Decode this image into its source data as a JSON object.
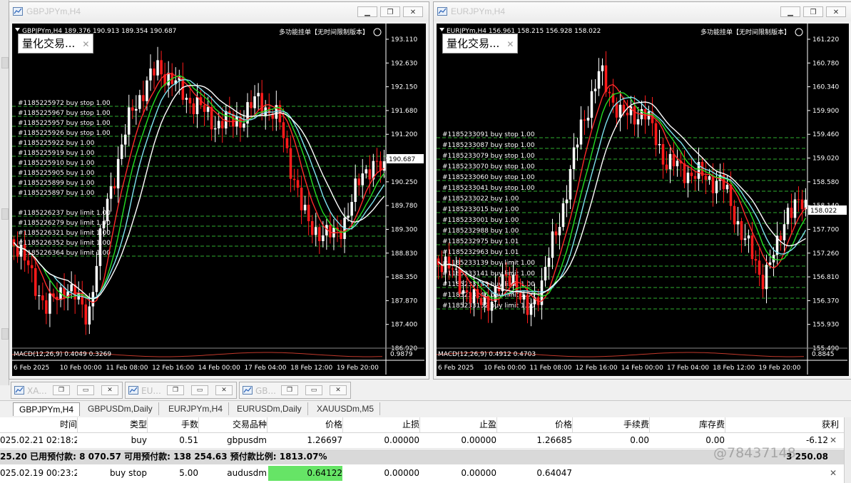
{
  "colors": {
    "bull": "#ffffff",
    "bear": "#ff1a1a",
    "ma_red": "#ff2a2a",
    "ma_green": "#22dd22",
    "ma_cyan": "#7fe3f0",
    "ma_white": "#ffffff",
    "grid_dash": "#2fae2f",
    "macd": "#c0392b"
  },
  "icons": {
    "chart_window": "chart-window-icon",
    "minimize": "minimize-icon",
    "restore": "restore-icon",
    "close": "close-icon",
    "smiley": "smiley-icon"
  },
  "windows": [
    {
      "id": "w1",
      "title": "GBPJPYm,H4",
      "header": "GBPJPYm,H4  189.376 190.913 189.354 190.687",
      "ea_label": "多功能挂单【无时间限制版本】",
      "panel_label": "量化交易...",
      "macd_label": "MACD(12,26,9) 0.4049 0.3269",
      "macd_right": "0.9879",
      "price_badge": "190.687",
      "y_ticks": [
        "193.110",
        "192.630",
        "192.150",
        "191.680",
        "191.200",
        "190.720",
        "190.250",
        "189.780",
        "189.300",
        "188.830",
        "188.350",
        "187.870",
        "187.400",
        "186.920"
      ],
      "x_ticks": [
        "6 Feb 2025",
        "10 Feb 00:00",
        "11 Feb 08:00",
        "12 Feb 16:00",
        "14 Feb 00:00",
        "17 Feb 04:00",
        "18 Feb 12:00",
        "19 Feb 20:00"
      ],
      "orders": [
        "#1185225972 buy stop 1.00",
        "#1185225967 buy stop 1.00",
        "#1185225957 buy stop 1.00",
        "#1185225926 buy stop 1.00",
        "#1185225922 buy 1.00",
        "#1185225919 buy 1.00",
        "#1185225910 buy 1.00",
        "#1185225905 buy 1.00",
        "#1185225899 buy 1.00",
        "#1185225897 buy 1.00",
        "#1185226237 buy limit 1.00",
        "#1185226279 buy limit 1.00",
        "#1185226321 buy limit 1.00",
        "#1185226352 buy limit 1.00",
        "#1185226364 buy limit 1.00"
      ]
    },
    {
      "id": "w2",
      "title": "EURJPYm,H4",
      "header": "EURJPYm,H4  156.961 158.215 156.928 158.022",
      "ea_label": "多功能挂单【无时间限制版本】",
      "panel_label": "量化交易...",
      "macd_label": "MACD(12,26,9) 0.4912 0.4703",
      "macd_right": "0.8845",
      "price_badge": "158.022",
      "y_ticks": [
        "161.220",
        "160.780",
        "160.340",
        "159.900",
        "159.460",
        "159.020",
        "158.580",
        "158.140",
        "157.700",
        "157.260",
        "156.810",
        "156.370",
        "155.930",
        "155.490"
      ],
      "x_ticks": [
        "6 Feb 2025",
        "10 Feb 00:00",
        "11 Feb 08:00",
        "12 Feb 16:00",
        "14 Feb 00:00",
        "17 Feb 04:00",
        "18 Feb 12:00",
        "19 Feb 20:00"
      ],
      "orders": [
        "#1185233091 buy stop 1.00",
        "#1185233087 buy stop 1.00",
        "#1185233079 buy stop 1.00",
        "#1185233070 buy stop 1.00",
        "#1185233060 buy stop 1.00",
        "#1185233041 buy stop 1.00",
        "#1185233022 buy 1.00",
        "#1185233015 buy 1.00",
        "#1185233001 buy 1.00",
        "#1185232988 buy 1.00",
        "#1185232975 buy 1.01",
        "#1185232963 buy 1.01",
        "#1185233139 buy limit 1.00",
        "#1185233141 buy limit 1.00",
        "#1185233143 buy limit 1.00",
        "#1185233146 buy limit 1.00",
        "#1185233152 buy limit 1.00"
      ]
    }
  ],
  "minimized": [
    {
      "title": "XA..."
    },
    {
      "title": "EU..."
    },
    {
      "title": "GB..."
    }
  ],
  "tabs": [
    "GBPJPYm,H4",
    "GBPUSDm,Daily",
    "EURJPYm,H4",
    "EURUSDm,Daily",
    "XAUUSDm,M5"
  ],
  "terminal": {
    "headers": [
      "时间",
      "类型",
      "手数",
      "交易品种",
      "价格",
      "止损",
      "止盈",
      "价格",
      "手续费",
      "库存费",
      "获利"
    ],
    "row1": [
      "025.02.21 02:18:22",
      "buy",
      "0.51",
      "gbpusdm",
      "1.26697",
      "0.00000",
      "0.00000",
      "1.26685",
      "0.00",
      "0.00",
      "-6.12"
    ],
    "balance": "25.20  已用预付款: 8 070.57  可用预付款: 138 254.63  预付款比例: 1813.07%",
    "balance_right": "3 250.08",
    "row2": [
      "025.02.19 00:23:28",
      "buy stop",
      "5.00",
      "audusdm",
      "0.64122",
      "0.00000",
      "0.00000",
      "0.64047",
      "",
      "",
      ""
    ]
  },
  "watermark": "@78437148"
}
